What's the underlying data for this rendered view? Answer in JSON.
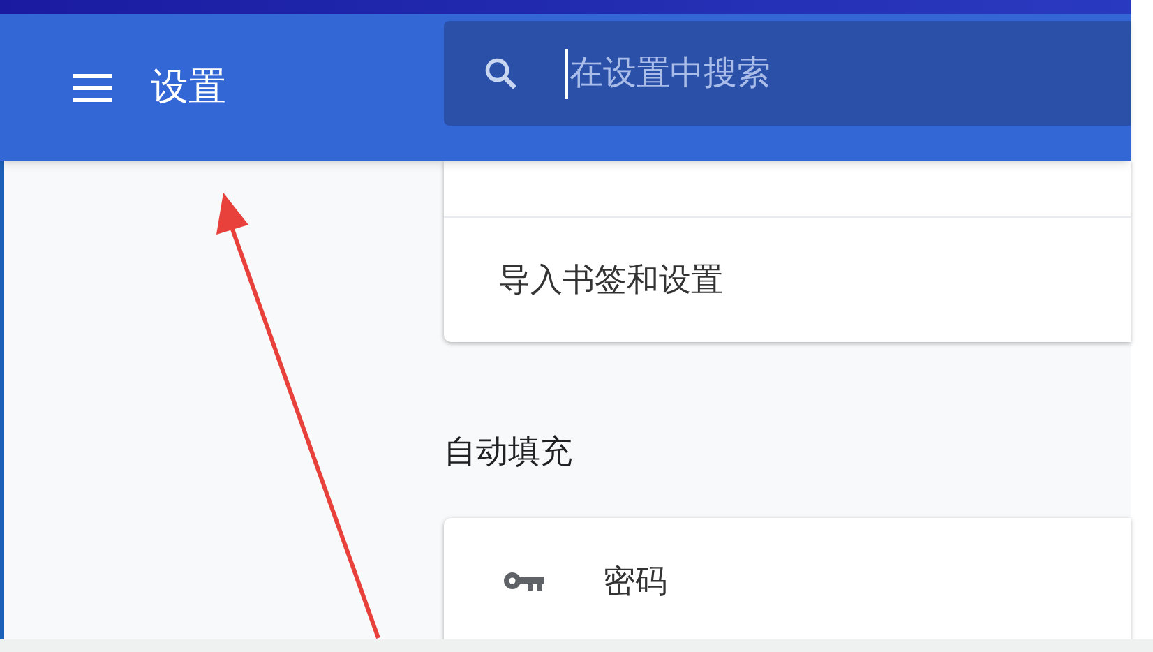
{
  "header": {
    "title": "设置",
    "search": {
      "placeholder": "在设置中搜索"
    }
  },
  "sections": [
    {
      "rows": [
        {
          "label": "导入书签和设置"
        }
      ]
    },
    {
      "title": "自动填充",
      "rows": [
        {
          "kind": "key",
          "label": "密码"
        }
      ]
    }
  ]
}
